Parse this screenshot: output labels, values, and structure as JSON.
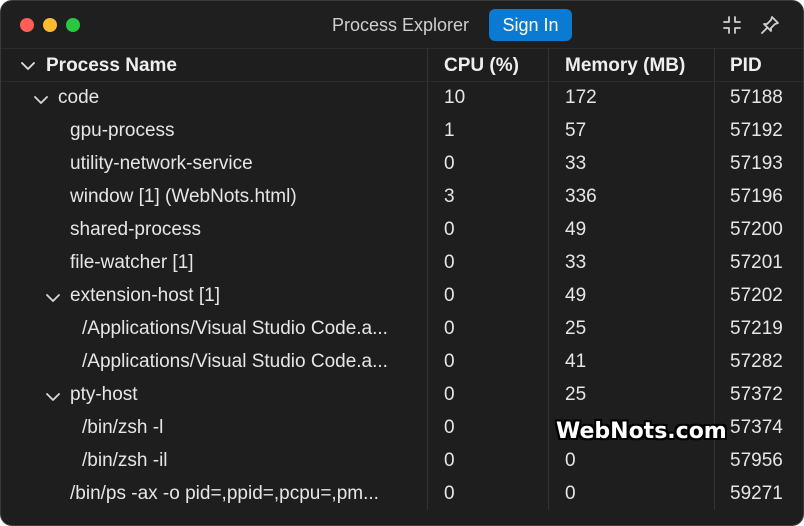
{
  "window": {
    "title": "Process Explorer",
    "sign_in_label": "Sign In"
  },
  "table": {
    "columns": [
      "Process Name",
      "CPU (%)",
      "Memory (MB)",
      "PID"
    ],
    "rows": [
      {
        "name": "code",
        "cpu": "10",
        "memory": "172",
        "pid": "57188",
        "depth": 0,
        "expandable": true,
        "expanded": true
      },
      {
        "name": "gpu-process",
        "cpu": "1",
        "memory": "57",
        "pid": "57192",
        "depth": 1,
        "expandable": false
      },
      {
        "name": "utility-network-service",
        "cpu": "0",
        "memory": "33",
        "pid": "57193",
        "depth": 1,
        "expandable": false
      },
      {
        "name": "window [1] (WebNots.html)",
        "cpu": "3",
        "memory": "336",
        "pid": "57196",
        "depth": 1,
        "expandable": false
      },
      {
        "name": "shared-process",
        "cpu": "0",
        "memory": "49",
        "pid": "57200",
        "depth": 1,
        "expandable": false
      },
      {
        "name": "file-watcher [1]",
        "cpu": "0",
        "memory": "33",
        "pid": "57201",
        "depth": 1,
        "expandable": false
      },
      {
        "name": "extension-host [1]",
        "cpu": "0",
        "memory": "49",
        "pid": "57202",
        "depth": 1,
        "expandable": true,
        "expanded": true
      },
      {
        "name": "/Applications/Visual Studio Code.a...",
        "cpu": "0",
        "memory": "25",
        "pid": "57219",
        "depth": 2,
        "expandable": false
      },
      {
        "name": "/Applications/Visual Studio Code.a...",
        "cpu": "0",
        "memory": "41",
        "pid": "57282",
        "depth": 2,
        "expandable": false
      },
      {
        "name": "pty-host",
        "cpu": "0",
        "memory": "25",
        "pid": "57372",
        "depth": 1,
        "expandable": true,
        "expanded": true
      },
      {
        "name": "/bin/zsh -l",
        "cpu": "0",
        "memory": "",
        "pid": "57374",
        "depth": 2,
        "expandable": false
      },
      {
        "name": "/bin/zsh -il",
        "cpu": "0",
        "memory": "0",
        "pid": "57956",
        "depth": 2,
        "expandable": false
      },
      {
        "name": "/bin/ps -ax -o pid=,ppid=,pcpu=,pm...",
        "cpu": "0",
        "memory": "0",
        "pid": "59271",
        "depth": 1,
        "expandable": false
      }
    ]
  },
  "watermark": "WebNots.com",
  "icons": {
    "title_right": [
      "collapse-icon",
      "pin-icon"
    ],
    "tree_toggle": "chevron-down-icon"
  },
  "colors": {
    "background": "#1e1e1e",
    "accent": "#0a7ad3",
    "close": "#ff5f57",
    "minimize": "#febc2e",
    "zoom": "#28c840"
  }
}
